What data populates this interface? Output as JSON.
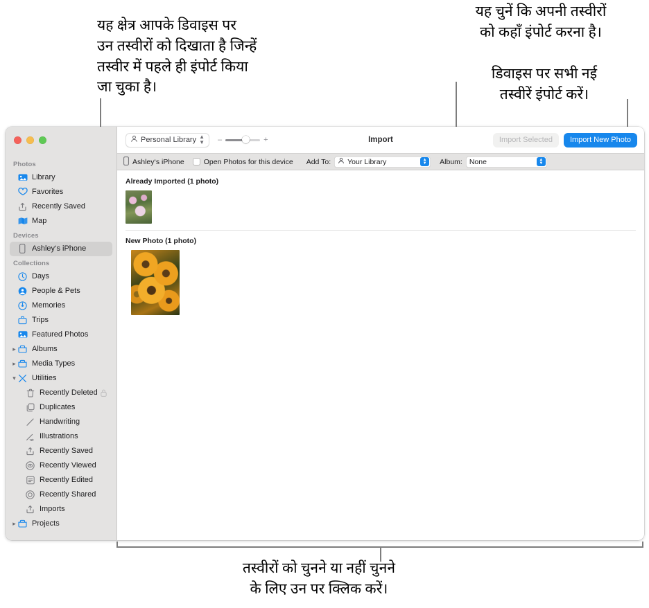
{
  "annotations": {
    "left": "यह क्षेत्र आपके डिवाइस पर\nउन तस्वीरों को दिखाता है जिन्हें\nतस्वीर में पहले ही इंपोर्ट किया\nजा चुका है।",
    "right_top": "यह चुनें कि अपनी तस्वीरों\nको कहाँ इंपोर्ट करना है।",
    "right_bottom": "डिवाइस पर सभी नई\nतस्वीरें इंपोर्ट करें।",
    "bottom": "तस्वीरों को चुनने या नहीं चुनने\nके लिए उन पर क्लिक करें।"
  },
  "window": {
    "traffic_lights": [
      "close-button",
      "minimize-button",
      "zoom-button"
    ]
  },
  "toolbar": {
    "library_popup": "Personal Library",
    "zoom_minus": "–",
    "zoom_plus": "+",
    "title": "Import",
    "import_selected_label": "Import Selected",
    "import_new_label": "Import New Photo",
    "accent_color": "#1787ec",
    "disabled_color": "#b6b6b8"
  },
  "devicebar": {
    "device_name": "Ashley‘s iPhone",
    "open_photos_label": "Open Photos for this device",
    "add_to_label": "Add To:",
    "add_to_value": "Your Library",
    "album_label": "Album:",
    "album_value": "None"
  },
  "sidebar": {
    "groups": [
      {
        "header": "Photos",
        "items": [
          {
            "label": "Library",
            "icon": "library-icon",
            "indent": 0,
            "selected": false,
            "disclosure": "",
            "lock": false
          },
          {
            "label": "Favorites",
            "icon": "heart-icon",
            "indent": 0,
            "selected": false,
            "disclosure": "",
            "lock": false
          },
          {
            "label": "Recently Saved",
            "icon": "save-arrow-icon",
            "indent": 0,
            "selected": false,
            "disclosure": "",
            "lock": false
          },
          {
            "label": "Map",
            "icon": "map-icon",
            "indent": 0,
            "selected": false,
            "disclosure": "",
            "lock": false
          }
        ]
      },
      {
        "header": "Devices",
        "items": [
          {
            "label": "Ashley‘s iPhone",
            "icon": "iphone-icon",
            "indent": 0,
            "selected": true,
            "disclosure": "",
            "lock": false
          }
        ]
      },
      {
        "header": "Collections",
        "items": [
          {
            "label": "Days",
            "icon": "clock-icon",
            "indent": 0,
            "selected": false,
            "disclosure": "",
            "lock": false
          },
          {
            "label": "People & Pets",
            "icon": "person-circle-icon",
            "indent": 0,
            "selected": false,
            "disclosure": "",
            "lock": false
          },
          {
            "label": "Memories",
            "icon": "memories-icon",
            "indent": 0,
            "selected": false,
            "disclosure": "",
            "lock": false
          },
          {
            "label": "Trips",
            "icon": "suitcase-icon",
            "indent": 0,
            "selected": false,
            "disclosure": "",
            "lock": false
          },
          {
            "label": "Featured Photos",
            "icon": "featured-photo-icon",
            "indent": 0,
            "selected": false,
            "disclosure": "",
            "lock": false
          },
          {
            "label": "Albums",
            "icon": "folder-icon",
            "indent": 0,
            "selected": false,
            "disclosure": "▸",
            "lock": false
          },
          {
            "label": "Media Types",
            "icon": "folder-icon",
            "indent": 0,
            "selected": false,
            "disclosure": "▸",
            "lock": false
          },
          {
            "label": "Utilities",
            "icon": "tools-icon",
            "indent": 0,
            "selected": false,
            "disclosure": "▾",
            "lock": false
          },
          {
            "label": "Recently Deleted",
            "icon": "trash-icon",
            "indent": 1,
            "selected": false,
            "disclosure": "",
            "lock": true
          },
          {
            "label": "Duplicates",
            "icon": "duplicates-icon",
            "indent": 1,
            "selected": false,
            "disclosure": "",
            "lock": false
          },
          {
            "label": "Handwriting",
            "icon": "pen-stroke-icon",
            "indent": 1,
            "selected": false,
            "disclosure": "",
            "lock": false
          },
          {
            "label": "Illustrations",
            "icon": "illustrations-icon",
            "indent": 1,
            "selected": false,
            "disclosure": "",
            "lock": false
          },
          {
            "label": "Recently Saved",
            "icon": "save-arrow-icon",
            "indent": 1,
            "selected": false,
            "disclosure": "",
            "lock": false
          },
          {
            "label": "Recently Viewed",
            "icon": "eye-circle-icon",
            "indent": 1,
            "selected": false,
            "disclosure": "",
            "lock": false
          },
          {
            "label": "Recently Edited",
            "icon": "edited-icon",
            "indent": 1,
            "selected": false,
            "disclosure": "",
            "lock": false
          },
          {
            "label": "Recently Shared",
            "icon": "shared-icon",
            "indent": 1,
            "selected": false,
            "disclosure": "",
            "lock": false
          },
          {
            "label": "Imports",
            "icon": "save-arrow-icon",
            "indent": 1,
            "selected": false,
            "disclosure": "",
            "lock": false
          },
          {
            "label": "Projects",
            "icon": "folder-icon",
            "indent": 0,
            "selected": false,
            "disclosure": "▸",
            "lock": false
          }
        ]
      }
    ]
  },
  "content": {
    "sections": [
      {
        "title": "Already Imported (1 photo)",
        "photo_alt": "pink-flowers-thumbnail"
      },
      {
        "title": "New Photo (1 photo)",
        "photo_alt": "orange-sunflowers-thumbnail"
      }
    ]
  }
}
